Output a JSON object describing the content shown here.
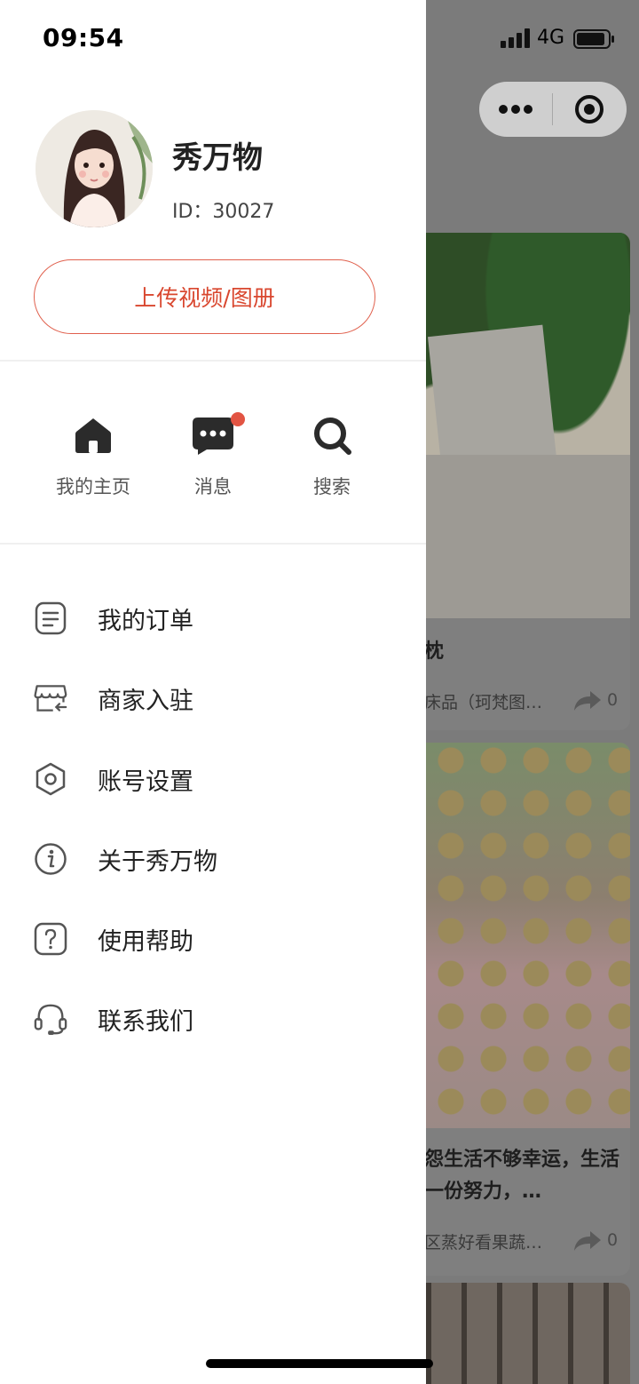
{
  "status_bar": {
    "time": "09:54",
    "network": "4G"
  },
  "profile": {
    "name": "秀万物",
    "id_text": "ID：30027"
  },
  "upload_button": {
    "label": "上传视频/图册"
  },
  "quick_actions": [
    {
      "label": "我的主页",
      "icon": "home-icon"
    },
    {
      "label": "消息",
      "icon": "message-icon",
      "has_badge": true
    },
    {
      "label": "搜索",
      "icon": "search-icon"
    }
  ],
  "menu": [
    {
      "label": "我的订单",
      "icon": "order-list-icon"
    },
    {
      "label": "商家入驻",
      "icon": "store-icon"
    },
    {
      "label": "账号设置",
      "icon": "settings-hexagon-icon"
    },
    {
      "label": "关于秀万物",
      "icon": "info-icon"
    },
    {
      "label": "使用帮助",
      "icon": "help-icon"
    },
    {
      "label": "联系我们",
      "icon": "headset-icon"
    }
  ],
  "background_feed": {
    "cards": [
      {
        "title": "枕",
        "meta": "床品（珂梵图…",
        "share_count": "0"
      },
      {
        "title": "怨生活不够幸运，生活一份努力，…",
        "meta": "区蒸好看果蔬…",
        "share_count": "0"
      }
    ]
  },
  "colors": {
    "accent": "#d9472f",
    "badge": "#e25443",
    "overlay": "#7b7b7b"
  }
}
